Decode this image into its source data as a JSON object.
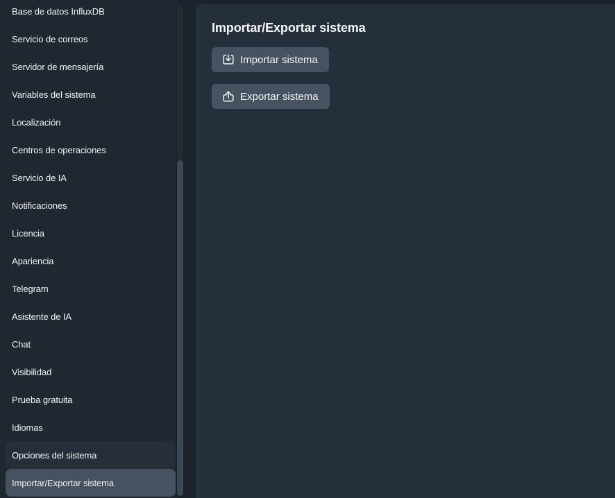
{
  "sidebar": {
    "items": [
      {
        "label": "Base de datos InfluxDB"
      },
      {
        "label": "Servicio de correos"
      },
      {
        "label": "Servidor de mensajería"
      },
      {
        "label": "Variables del sistema"
      },
      {
        "label": "Localización"
      },
      {
        "label": "Centros de operaciones"
      },
      {
        "label": "Servicio de IA"
      },
      {
        "label": "Notificaciones"
      },
      {
        "label": "Licencia"
      },
      {
        "label": "Apariencia"
      },
      {
        "label": "Telegram"
      },
      {
        "label": "Asistente de IA"
      },
      {
        "label": "Chat"
      },
      {
        "label": "Visibilidad"
      },
      {
        "label": "Prueba gratuita"
      },
      {
        "label": "Idiomas"
      },
      {
        "label": "Opciones del sistema"
      },
      {
        "label": "Importar/Exportar sistema"
      }
    ],
    "active_item": "Importar/Exportar sistema"
  },
  "main": {
    "title": "Importar/Exportar sistema",
    "import_button": {
      "label": "Importar sistema",
      "icon": "import-icon"
    },
    "export_button": {
      "label": "Exportar sistema",
      "icon": "export-icon"
    }
  },
  "colors": {
    "sidebar_bg": "#1f2730",
    "main_bg": "#252f3b",
    "button_bg": "#465260",
    "active_item_bg": "#46525f",
    "text": "#f1f4f7"
  }
}
